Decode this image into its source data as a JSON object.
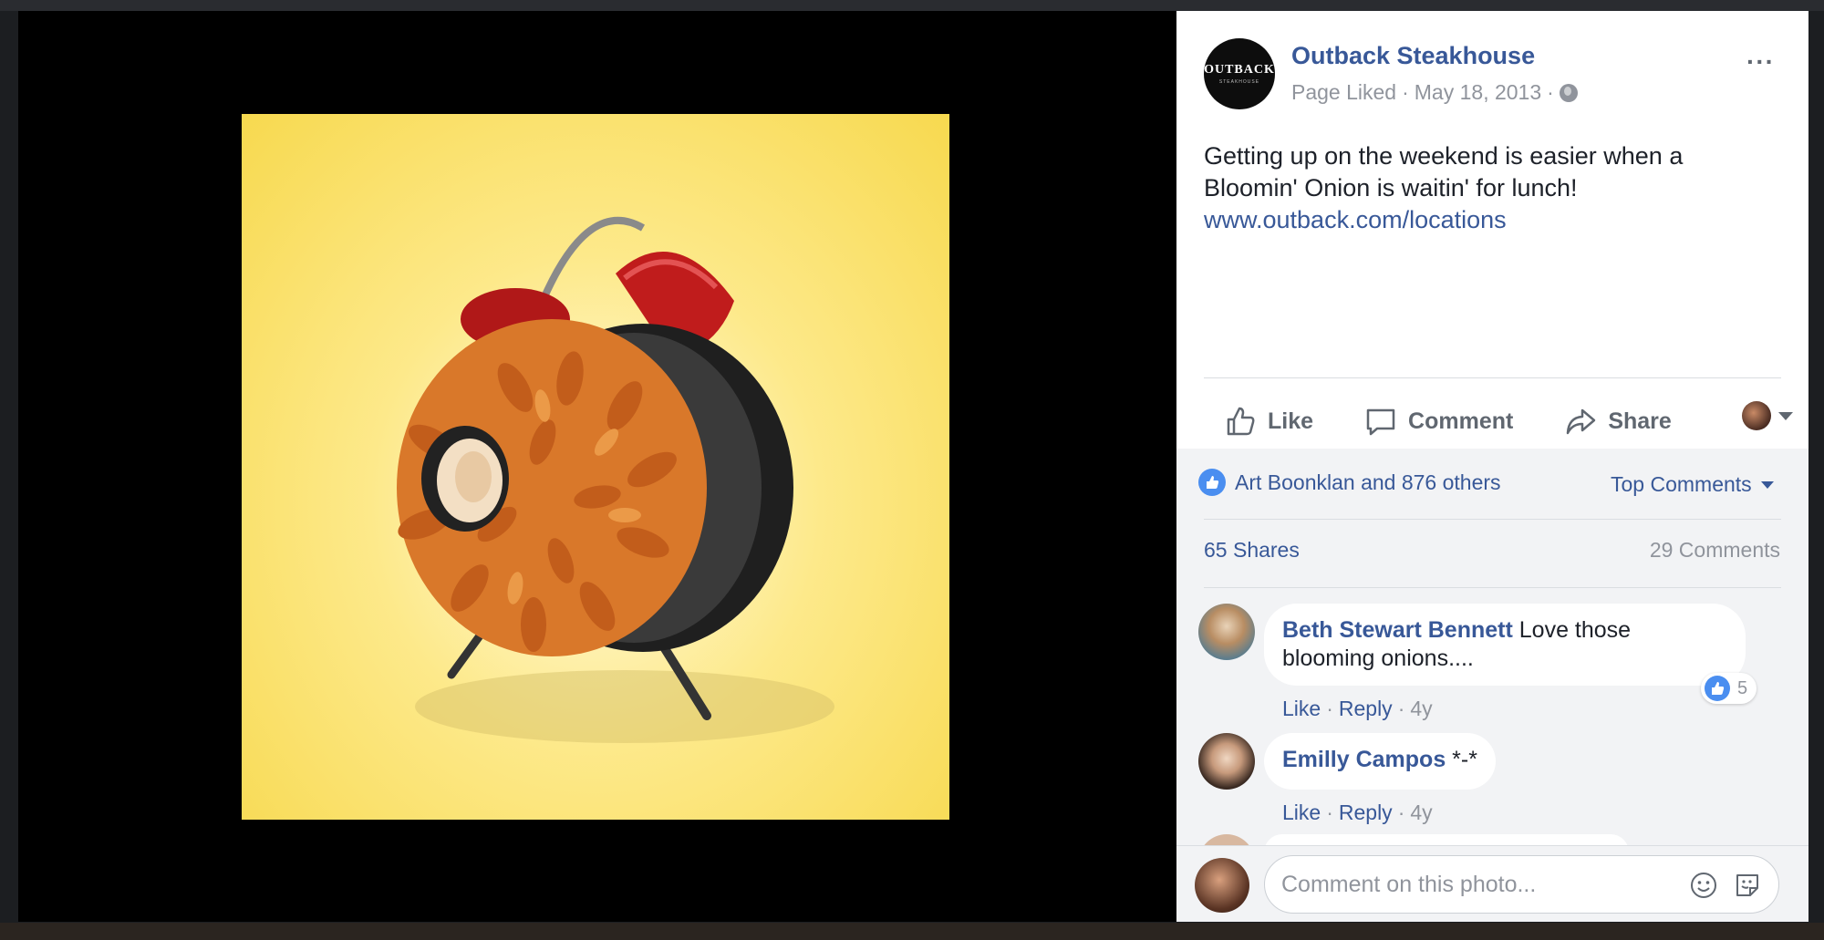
{
  "post": {
    "page_name": "Outback Steakhouse",
    "logo_text": "OUTBACK",
    "logo_sub": "STEAKHOUSE",
    "status": "Page Liked",
    "date": "May 18, 2013",
    "separator": "·",
    "more_label": "···",
    "text_line1": "Getting up on the weekend is easier when a Bloomin' Onion is waitin' for lunch!",
    "link": "www.outback.com/locations"
  },
  "actions": {
    "like": "Like",
    "comment": "Comment",
    "share": "Share"
  },
  "engagement": {
    "reactions_text": "Art Boonklan and 876 others",
    "sort_label": "Top Comments",
    "shares": "65 Shares",
    "comments": "29 Comments"
  },
  "comments": [
    {
      "author": "Beth Stewart Bennett",
      "text": " Love those",
      "text2": "blooming onions....",
      "like": "Like",
      "reply": "Reply",
      "time": "4y",
      "reaction_count": "5"
    },
    {
      "author": "Emilly Campos",
      "text": " *-*",
      "like": "Like",
      "reply": "Reply",
      "time": "4y"
    }
  ],
  "composer": {
    "placeholder": "Comment on this photo..."
  },
  "colors": {
    "link_blue": "#385898",
    "like_blue": "#4a8ef0",
    "photo_bg": "#f7d94f"
  }
}
